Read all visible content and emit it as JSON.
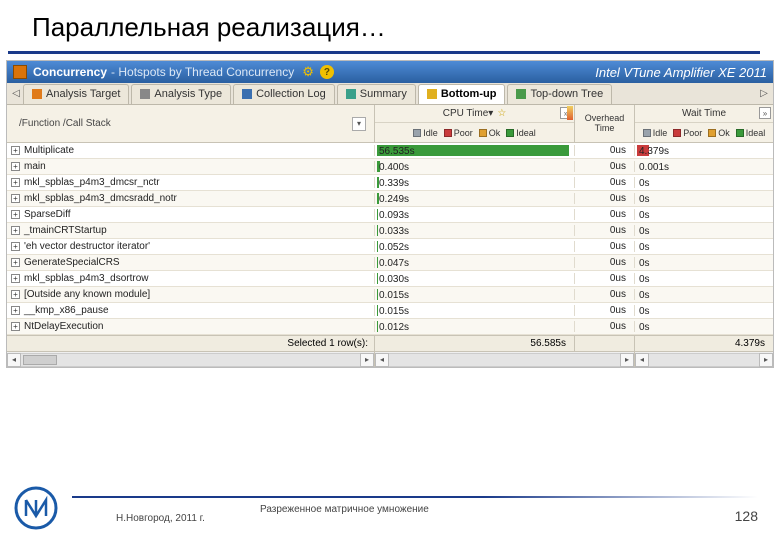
{
  "slide": {
    "title": "Параллельная реализация…",
    "footer_location": "Н.Новгород, 2011 г.",
    "footer_subtitle": "Разреженное матричное умножение",
    "page_number": "128"
  },
  "header": {
    "title_strong": "Concurrency",
    "title_sub": "- Hotspots by Thread Concurrency",
    "brand": "Intel VTune Amplifier XE 2011"
  },
  "tabs": [
    {
      "icon": "orange",
      "label": "Analysis Target",
      "active": false
    },
    {
      "icon": "gray",
      "label": "Analysis Type",
      "active": false
    },
    {
      "icon": "blue",
      "label": "Collection Log",
      "active": false
    },
    {
      "icon": "teal",
      "label": "Summary",
      "active": false
    },
    {
      "icon": "yellow",
      "label": "Bottom-up",
      "active": true
    },
    {
      "icon": "green",
      "label": "Top-down Tree",
      "active": false
    }
  ],
  "columns": {
    "func_label": "/Function /Call Stack",
    "cpu_time_label": "CPU Time",
    "overhead_label": "Overhead Time",
    "wait_time_label": "Wait Time",
    "legend": [
      "Idle",
      "Poor",
      "Ok",
      "Ideal"
    ]
  },
  "rows": [
    {
      "name": "Multiplicate",
      "cpu": "56.535s",
      "cpu_bar": 192,
      "ov": "0us",
      "wait": "4.379s",
      "wait_bar": 12
    },
    {
      "name": "main",
      "cpu": "0.400s",
      "cpu_bar": 3,
      "ov": "0us",
      "wait": "0.001s",
      "wait_bar": 0
    },
    {
      "name": "mkl_spblas_p4m3_dmcsr_nctr",
      "cpu": "0.339s",
      "cpu_bar": 2,
      "ov": "0us",
      "wait": "0s",
      "wait_bar": 0
    },
    {
      "name": "mkl_spblas_p4m3_dmcsradd_notr",
      "cpu": "0.249s",
      "cpu_bar": 2,
      "ov": "0us",
      "wait": "0s",
      "wait_bar": 0
    },
    {
      "name": "SparseDiff",
      "cpu": "0.093s",
      "cpu_bar": 1,
      "ov": "0us",
      "wait": "0s",
      "wait_bar": 0
    },
    {
      "name": "_tmainCRTStartup",
      "cpu": "0.033s",
      "cpu_bar": 1,
      "ov": "0us",
      "wait": "0s",
      "wait_bar": 0
    },
    {
      "name": "'eh vector destructor iterator'",
      "cpu": "0.052s",
      "cpu_bar": 1,
      "ov": "0us",
      "wait": "0s",
      "wait_bar": 0
    },
    {
      "name": "GenerateSpecialCRS",
      "cpu": "0.047s",
      "cpu_bar": 1,
      "ov": "0us",
      "wait": "0s",
      "wait_bar": 0
    },
    {
      "name": "mkl_spblas_p4m3_dsortrow",
      "cpu": "0.030s",
      "cpu_bar": 1,
      "ov": "0us",
      "wait": "0s",
      "wait_bar": 0
    },
    {
      "name": "[Outside any known module]",
      "cpu": "0.015s",
      "cpu_bar": 1,
      "ov": "0us",
      "wait": "0s",
      "wait_bar": 0
    },
    {
      "name": "__kmp_x86_pause",
      "cpu": "0.015s",
      "cpu_bar": 1,
      "ov": "0us",
      "wait": "0s",
      "wait_bar": 0
    },
    {
      "name": "NtDelayExecution",
      "cpu": "0.012s",
      "cpu_bar": 1,
      "ov": "0us",
      "wait": "0s",
      "wait_bar": 0
    }
  ],
  "summary": {
    "label": "Selected 1 row(s):",
    "cpu_total": "56.585s",
    "wait_total": "4.379s"
  }
}
